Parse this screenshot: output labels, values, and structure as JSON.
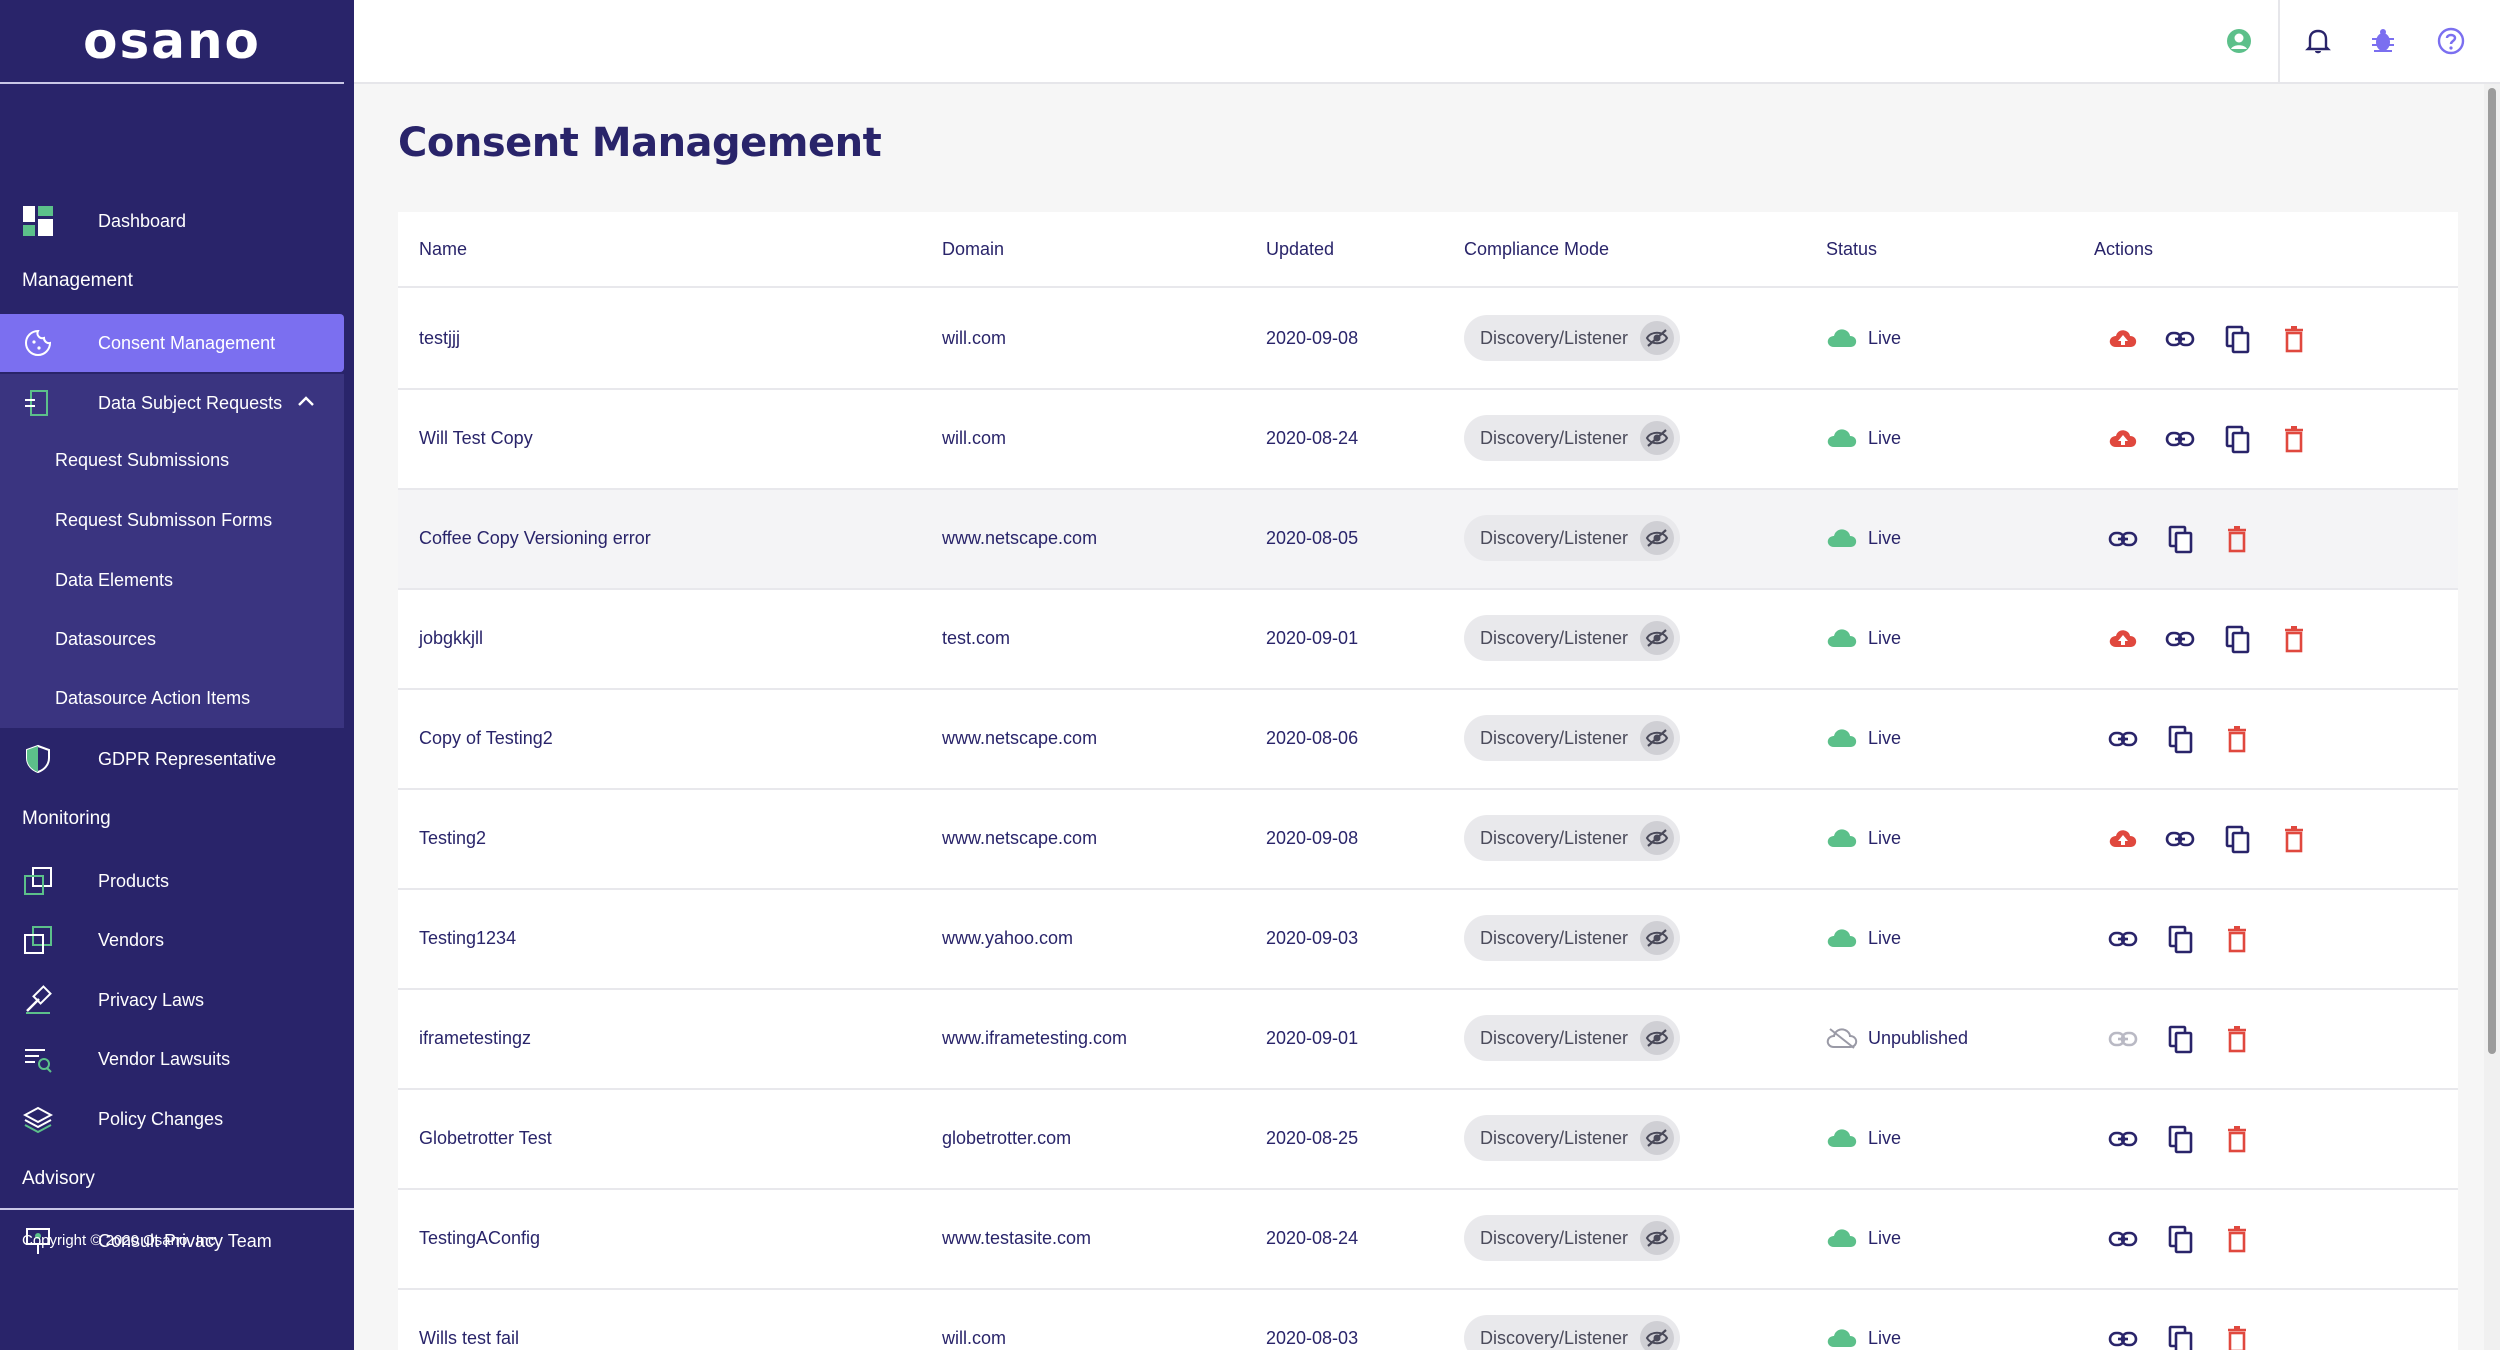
{
  "brand": {
    "logo": "osano"
  },
  "sidebar": {
    "dashboard": "Dashboard",
    "sections": {
      "management": "Management",
      "monitoring": "Monitoring",
      "advisory": "Advisory"
    },
    "consent_management": "Consent Management",
    "data_subject_requests": "Data Subject Requests",
    "sub_items": [
      "Request Submissions",
      "Request Submisson Forms",
      "Data Elements",
      "Datasources",
      "Datasource Action Items"
    ],
    "gdpr": "GDPR Representative",
    "monitoring_items": [
      "Products",
      "Vendors",
      "Privacy Laws",
      "Vendor Lawsuits",
      "Policy Changes"
    ],
    "consult": "Consult Privacy Team",
    "copyright": "Copyright © 2020 Osano, Inc."
  },
  "page": {
    "title": "Consent Management"
  },
  "table": {
    "headers": {
      "name": "Name",
      "domain": "Domain",
      "updated": "Updated",
      "mode": "Compliance Mode",
      "status": "Status",
      "actions": "Actions"
    },
    "rows": [
      {
        "name": "testjjj",
        "domain": "will.com",
        "updated": "2020-09-08",
        "mode": "Discovery/Listener",
        "status": "Live",
        "publish": true
      },
      {
        "name": "Will Test Copy",
        "domain": "will.com",
        "updated": "2020-08-24",
        "mode": "Discovery/Listener",
        "status": "Live",
        "publish": true
      },
      {
        "name": "Coffee Copy Versioning error",
        "domain": "www.netscape.com",
        "updated": "2020-08-05",
        "mode": "Discovery/Listener",
        "status": "Live",
        "publish": false
      },
      {
        "name": "jobgkkjll",
        "domain": "test.com",
        "updated": "2020-09-01",
        "mode": "Discovery/Listener",
        "status": "Live",
        "publish": true
      },
      {
        "name": "Copy of Testing2",
        "domain": "www.netscape.com",
        "updated": "2020-08-06",
        "mode": "Discovery/Listener",
        "status": "Live",
        "publish": false
      },
      {
        "name": "Testing2",
        "domain": "www.netscape.com",
        "updated": "2020-09-08",
        "mode": "Discovery/Listener",
        "status": "Live",
        "publish": true
      },
      {
        "name": "Testing1234",
        "domain": "www.yahoo.com",
        "updated": "2020-09-03",
        "mode": "Discovery/Listener",
        "status": "Live",
        "publish": false
      },
      {
        "name": "iframetestingz",
        "domain": "www.iframetesting.com",
        "updated": "2020-09-01",
        "mode": "Discovery/Listener",
        "status": "Unpublished",
        "publish": false
      },
      {
        "name": "Globetrotter Test",
        "domain": "globetrotter.com",
        "updated": "2020-08-25",
        "mode": "Discovery/Listener",
        "status": "Live",
        "publish": false
      },
      {
        "name": "TestingAConfig",
        "domain": "www.testasite.com",
        "updated": "2020-08-24",
        "mode": "Discovery/Listener",
        "status": "Live",
        "publish": false
      },
      {
        "name": "Wills test fail",
        "domain": "will.com",
        "updated": "2020-08-03",
        "mode": "Discovery/Listener",
        "status": "Live",
        "publish": false
      }
    ]
  },
  "colors": {
    "sidebar": "#29246a",
    "active": "#7b6ff0",
    "live": "#5cc08a",
    "danger": "#e0483e",
    "accent": "#7b6ff0"
  },
  "icons": {
    "publish": "cloud-upload-icon",
    "link": "link-icon",
    "copy": "copy-icon",
    "delete": "trash-icon",
    "mode": "eye-off-icon",
    "status_live": "cloud-icon",
    "status_unpublished": "cloud-off-icon"
  }
}
